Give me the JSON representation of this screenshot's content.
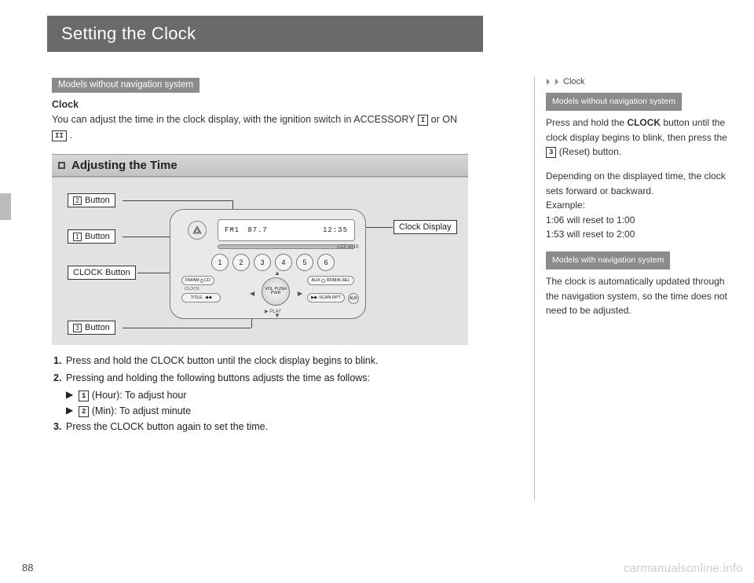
{
  "title": "Setting the Clock",
  "section_heading": "Adjusting the Time",
  "tag_without_nav": "Models without navigation system",
  "tag_with_nav": "Models with navigation system",
  "intro_prefix": "Clock",
  "intro_line": "You can adjust the time in the clock display, with the ignition switch in ACCESSORY ",
  "intro_glyph1": "I",
  "intro_mid": " or ON ",
  "intro_glyph2": "II",
  "intro_end": ".",
  "labels": {
    "btn2": "Button",
    "btn1": "Button",
    "clock_btn": "CLOCK Button",
    "btn3": "Button",
    "clock_display": "Clock Display",
    "mini1": "1",
    "mini2": "2",
    "mini3": "3"
  },
  "radio": {
    "band": "FM1",
    "freq": "87.7",
    "clock": "12:35",
    "presets": [
      "1",
      "2",
      "3",
      "4",
      "5",
      "6"
    ],
    "knob": "VOL\nPUSH\nPWR",
    "pill_fmam": "FM/AM",
    "pill_cd": "CD",
    "pill_clock": "CLOCK",
    "pill_aux": "AUX",
    "pill_rdm": "RDM/A.SEL",
    "pill_title": "TITLE",
    "pill_scan": "SCAN",
    "pill_rpt": "RPT",
    "rnd_aux": "AUX",
    "eject": "CD/\nAUX",
    "folder_up": "▲",
    "folder_dn": "▼",
    "seek_l": "◀",
    "seek_r": "▶",
    "play": "▶ PLAY"
  },
  "steps": {
    "s1": "Press and hold the CLOCK button until the clock display begins to blink.",
    "s2": "Pressing and holding the following buttons adjusts the time as follows:",
    "s2a_glyph": "1",
    "s2a": " (Hour): To adjust hour",
    "s2b_glyph": "2",
    "s2b": " (Min): To adjust minute",
    "s3": "Press the CLOCK button again to set the time."
  },
  "sidebar": {
    "heading": "Clock",
    "p1a": "Press and hold the ",
    "p1b": "CLOCK",
    "p1c": " button until the clock display begins to blink, then press the ",
    "p1d": "3",
    "p1e": " (Reset) button.",
    "p2": "Depending on the displayed time, the clock sets forward or backward.",
    "p3": "Example:",
    "p4": "1:06 will reset to 1:00",
    "p5": "1:53 will reset to 2:00",
    "p6": "The clock is automatically updated through the navigation system, so the time does not need to be adjusted."
  },
  "page_number": "88",
  "watermark": "carmanualsonline.info"
}
